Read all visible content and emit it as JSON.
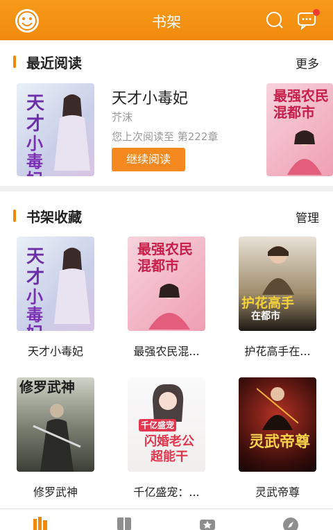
{
  "header": {
    "title": "书架",
    "avatar_icon": "smiley-avatar-icon",
    "search_icon": "search-icon",
    "message_icon": "message-icon",
    "accent": "#f18a0c"
  },
  "recent": {
    "section_title": "最近阅读",
    "more_label": "更多",
    "book": {
      "title": "天才小毒妃",
      "author": "芥沫",
      "progress": "您上次阅读至 第222章",
      "continue_label": "继续阅读"
    }
  },
  "shelf": {
    "section_title": "书架收藏",
    "manage_label": "管理",
    "books": [
      {
        "title": "天才小毒妃"
      },
      {
        "title": "最强农民混..."
      },
      {
        "title": "护花高手在..."
      },
      {
        "title": "修罗武神"
      },
      {
        "title": "千亿盛宠：..."
      },
      {
        "title": "灵武帝尊"
      }
    ]
  },
  "covers": {
    "c1": {
      "line1": "天才",
      "line2": "小毒妃"
    },
    "c2": {
      "line1": "最强农民",
      "line2": "混都市"
    },
    "c3": {
      "line1": "护花高手",
      "line2": "在都市"
    },
    "c4": {
      "line1": "修罗武神"
    },
    "c5": {
      "line1": "千亿盛宠",
      "line2": "闪婚老公",
      "line3": "超能干"
    },
    "c6": {
      "line1": "灵武帝尊"
    }
  },
  "bottom_nav": {
    "items": [
      "bookshelf-icon",
      "library-icon",
      "ranking-icon",
      "discover-icon"
    ]
  }
}
